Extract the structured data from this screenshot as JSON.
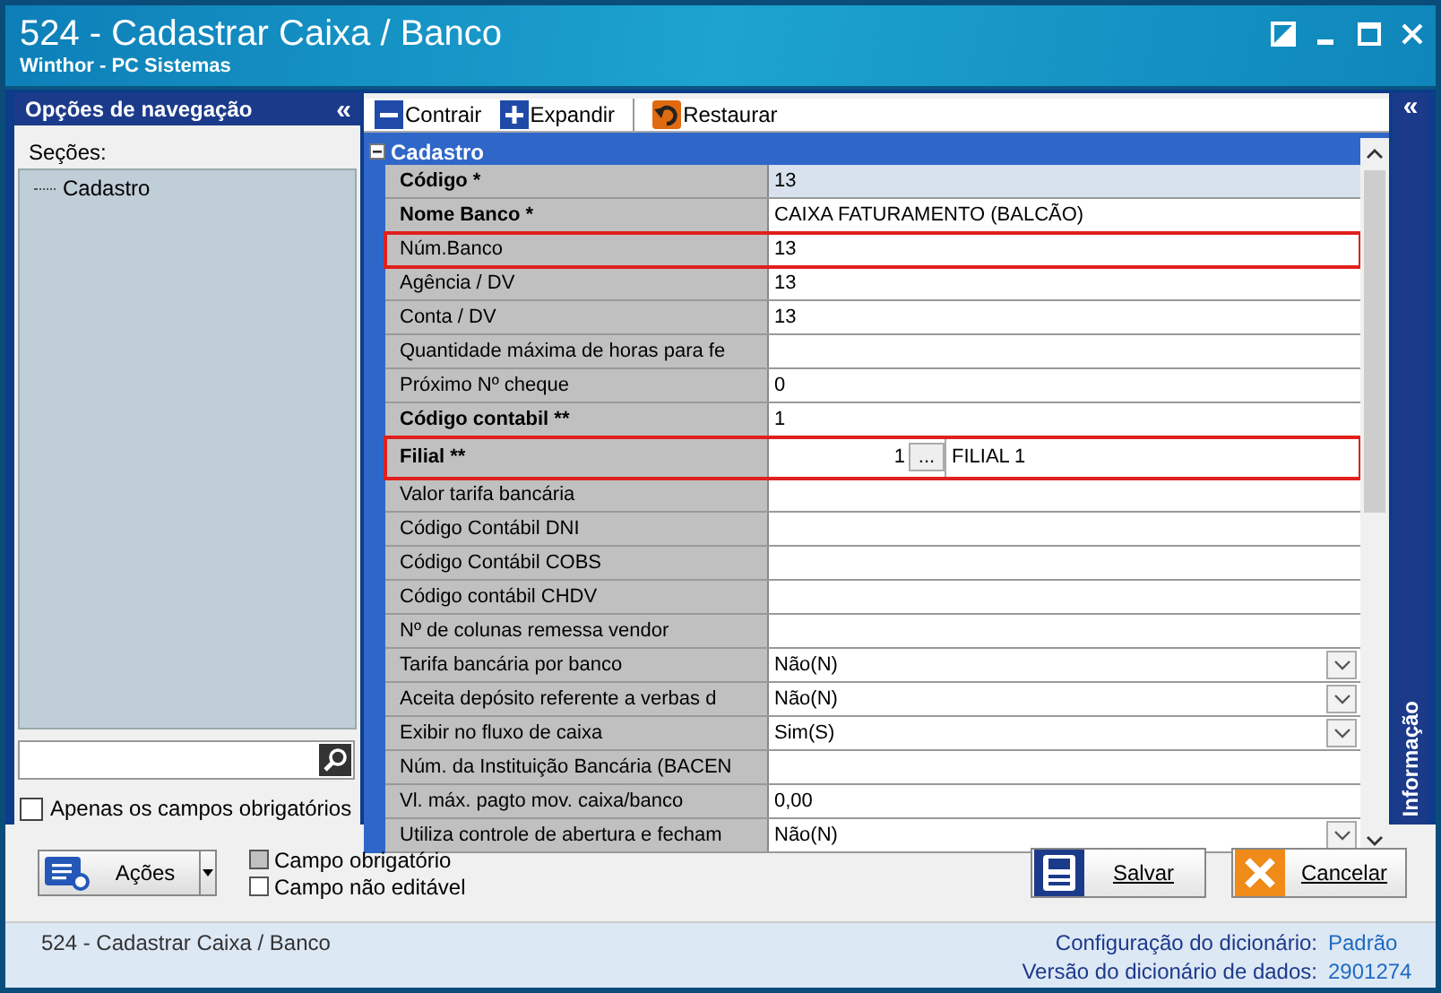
{
  "window": {
    "title": "524 - Cadastrar Caixa / Banco",
    "subtitle": "Winthor - PC Sistemas"
  },
  "navigation": {
    "title": "Opções de navegação",
    "collapse": "«",
    "group_label": "Seções:",
    "items": [
      {
        "label": "Cadastro"
      }
    ],
    "required_only": {
      "label": "Apenas os campos obrigatórios",
      "checked": false
    }
  },
  "toolbar": [
    {
      "label": "Contrair",
      "kind": "collapse"
    },
    {
      "label": "Expandir",
      "kind": "expand"
    },
    {
      "label": "Restaurar",
      "kind": "restore"
    }
  ],
  "section": {
    "title": "Cadastro",
    "expanded": true,
    "rows": [
      {
        "label": "Código *",
        "value": "13",
        "kind": "text",
        "bold": true,
        "selected": true,
        "highlighted": false
      },
      {
        "label": "Nome Banco *",
        "value": "CAIXA FATURAMENTO (BALCÃO)",
        "kind": "text",
        "bold": true,
        "selected": false,
        "highlighted": false
      },
      {
        "label": "Núm.Banco",
        "value": "13",
        "kind": "text",
        "bold": false,
        "selected": false,
        "highlighted": true
      },
      {
        "label": "Agência / DV",
        "value": "13",
        "kind": "text",
        "bold": false,
        "selected": false,
        "highlighted": false
      },
      {
        "label": "Conta / DV",
        "value": "13",
        "kind": "text",
        "bold": false,
        "selected": false,
        "highlighted": false
      },
      {
        "label": "Quantidade máxima de horas para fe",
        "kind": "text",
        "bold": false,
        "selected": false,
        "highlighted": false
      },
      {
        "label": "Próximo Nº cheque",
        "value": "0",
        "kind": "text",
        "bold": false,
        "selected": false,
        "highlighted": false
      },
      {
        "label": "Código contabil **",
        "value": "1",
        "kind": "text",
        "bold": true,
        "selected": false,
        "highlighted": false
      },
      {
        "label": "Filial **",
        "code": "1",
        "button": "...",
        "value": "FILIAL 1",
        "kind": "lookup",
        "bold": true,
        "selected": false,
        "highlighted": true
      },
      {
        "label": "Valor tarifa bancária",
        "kind": "text",
        "bold": false,
        "selected": false,
        "highlighted": false
      },
      {
        "label": "Código Contábil DNI",
        "kind": "text",
        "bold": false,
        "selected": false,
        "highlighted": false
      },
      {
        "label": "Código Contábil COBS",
        "kind": "text",
        "bold": false,
        "selected": false,
        "highlighted": false
      },
      {
        "label": "Código contábil CHDV",
        "kind": "text",
        "bold": false,
        "selected": false,
        "highlighted": false
      },
      {
        "label": "Nº de colunas remessa vendor",
        "kind": "text",
        "bold": false,
        "selected": false,
        "highlighted": false
      },
      {
        "label": "Tarifa bancária por banco",
        "value": "Não(N)",
        "kind": "select",
        "bold": false,
        "selected": false,
        "highlighted": false
      },
      {
        "label": "Aceita depósito referente a verbas d",
        "value": "Não(N)",
        "kind": "select",
        "bold": false,
        "selected": false,
        "highlighted": false
      },
      {
        "label": "Exibir no fluxo de caixa",
        "value": "Sim(S)",
        "kind": "select",
        "bold": false,
        "selected": false,
        "highlighted": false
      },
      {
        "label": "Núm. da Instituição Bancária (BACEN",
        "kind": "text",
        "bold": false,
        "selected": false,
        "highlighted": false
      },
      {
        "label": "Vl. máx. pagto mov. caixa/banco",
        "value": "0,00",
        "kind": "text",
        "bold": false,
        "selected": false,
        "highlighted": false
      },
      {
        "label": "Utiliza controle de abertura e fecham",
        "value": "Não(N)",
        "kind": "select",
        "bold": false,
        "selected": false,
        "highlighted": false
      }
    ]
  },
  "info_panel": {
    "collapse": "«",
    "title": "Informação"
  },
  "actions": {
    "label": "Ações"
  },
  "legend": [
    {
      "label": "Campo obrigatório",
      "kind": "required"
    },
    {
      "label": "Campo não editável",
      "kind": "readonly"
    }
  ],
  "buttons": [
    {
      "label": "Salvar",
      "kind": "save"
    },
    {
      "label": "Cancelar",
      "kind": "cancel"
    }
  ],
  "status_bar": {
    "text": "524 - Cadastrar Caixa / Banco",
    "entries": [
      {
        "key": "Configuração do dicionário:",
        "value": "Padrão"
      },
      {
        "key": "Versão do dicionário de dados:",
        "value": "2901274"
      }
    ]
  }
}
